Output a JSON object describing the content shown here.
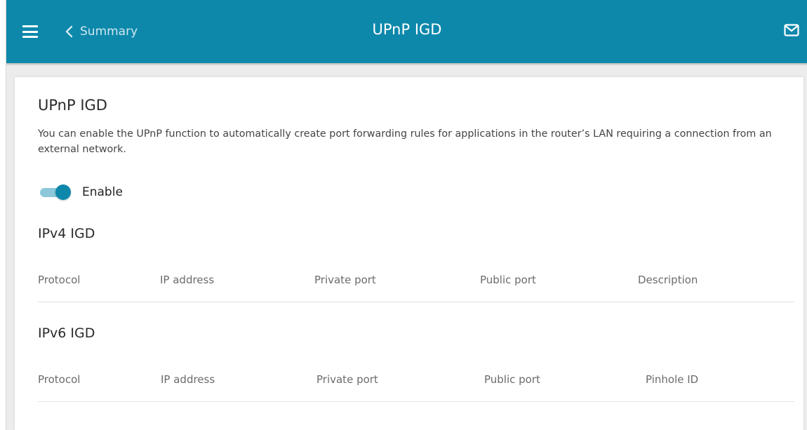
{
  "header": {
    "back_label": "Summary",
    "title": "UPnP IGD",
    "menu_icon": "hamburger-menu-icon",
    "back_icon": "chevron-left-icon",
    "mail_icon": "mail-icon",
    "bar_color": "#0d88ab"
  },
  "main": {
    "title": "UPnP IGD",
    "description": "You can enable the UPnP function to automatically create port forwarding rules for applications in the router’s LAN requiring a connection from an external network.",
    "enable_toggle": {
      "label": "Enable",
      "on": true
    },
    "ipv4": {
      "title": "IPv4 IGD",
      "columns": [
        "Protocol",
        "IP address",
        "Private port",
        "Public port",
        "Description"
      ]
    },
    "ipv6": {
      "title": "IPv6 IGD",
      "columns": [
        "Protocol",
        "IP address",
        "Private port",
        "Public port",
        "Pinhole ID"
      ]
    }
  }
}
